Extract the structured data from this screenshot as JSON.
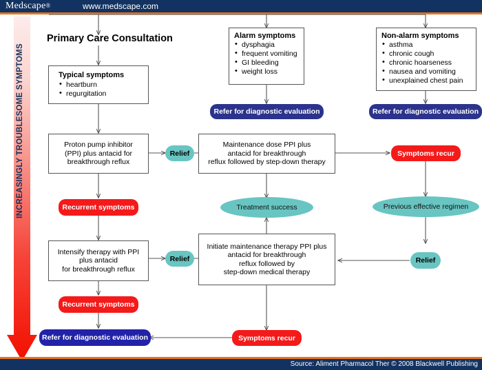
{
  "header": {
    "logo": "Medscape",
    "logo_reg": "®",
    "site": "www.medscape.com",
    "bg": "#123261",
    "rule": "#e8741c"
  },
  "footer": {
    "source": "Source: Aliment Pharmacol Ther © 2008 Blackwell Publishing"
  },
  "axis": {
    "label": "INCREASINGLY TROUBLESOME SYMPTOMS",
    "gradient_from": "#fbdedb",
    "gradient_to": "#f41a1a"
  },
  "flow": {
    "title": "Primary Care Consultation",
    "typical": {
      "heading": "Typical symptoms",
      "items": [
        "heartburn",
        "regurgitation"
      ]
    },
    "alarm": {
      "heading": "Alarm symptoms",
      "items": [
        "dysphagia",
        "frequent vomiting",
        "GI bleeding",
        "weight loss"
      ]
    },
    "nonalarm": {
      "heading": "Non-alarm symptoms",
      "items": [
        "asthma",
        "chronic cough",
        "chronic hoarseness",
        "nausea and vomiting",
        "unexplained chest pain"
      ]
    },
    "refer_alarm": "Refer for diagnostic evaluation",
    "refer_nonalarm": "Refer for diagnostic evaluation",
    "refer_final": "Refer for diagnostic evaluation",
    "ppi_initial": "Proton pump inhibitor (PPI) plus antacid for breakthrough reflux",
    "ppi_initial_lines": [
      "Proton pump inhibitor",
      "(PPI) plus antacid for",
      "breakthrough reflux"
    ],
    "maintenance_lines": [
      "Maintenance dose PPI plus",
      "antacid for breakthrough",
      "reflux followed by step-down therapy"
    ],
    "intensify_lines": [
      "Intensify therapy with PPI",
      "plus antacid",
      "for breakthrough reflux"
    ],
    "initiate_lines": [
      "Initiate maintenance therapy PPI plus",
      "antacid for breakthrough",
      "reflux followed by",
      "step-down medical therapy"
    ],
    "relief_1": "Relief",
    "relief_2": "Relief",
    "relief_3": "Relief",
    "treatment_success": "Treatment success",
    "previous_regimen": "Previous effective regimen",
    "symptoms_recur_1": "Symptoms recur",
    "symptoms_recur_2": "Symptoms recur",
    "recurrent_1": "Recurrent symptoms",
    "recurrent_2": "Recurrent symptoms"
  },
  "colors": {
    "navy_pill": "#2b338c",
    "blue_pill": "#2222a8",
    "red_pill": "#f41a1a",
    "teal": "#68c5c2",
    "box_border": "#555555",
    "wire": "#555555"
  }
}
